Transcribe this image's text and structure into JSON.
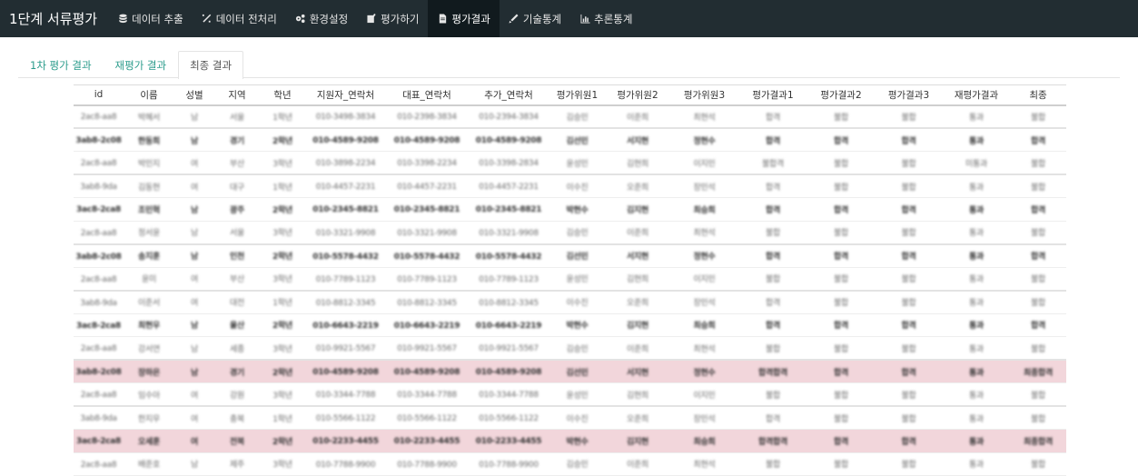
{
  "navbar": {
    "brand": "1단계 서류평가",
    "items": [
      {
        "label": "데이터 추출",
        "icon": "database-icon",
        "active": false
      },
      {
        "label": "데이터 전처리",
        "icon": "wand-icon",
        "active": false
      },
      {
        "label": "환경설정",
        "icon": "gears-icon",
        "active": false
      },
      {
        "label": "평가하기",
        "icon": "edit-icon",
        "active": false
      },
      {
        "label": "평가결과",
        "icon": "file-icon",
        "active": true
      },
      {
        "label": "기술통계",
        "icon": "pencil-icon",
        "active": false
      },
      {
        "label": "추론통계",
        "icon": "bar-chart-icon",
        "active": false
      }
    ]
  },
  "tabs": [
    {
      "label": "1차 평가 결과",
      "active": false
    },
    {
      "label": "재평가 결과",
      "active": false
    },
    {
      "label": "최종 결과",
      "active": true
    }
  ],
  "table": {
    "columns": [
      "id",
      "이름",
      "성별",
      "지역",
      "학년",
      "지원자_연락처",
      "대표_연락처",
      "추가_연락처",
      "평가위원1",
      "평가위원2",
      "평가위원3",
      "평가결과1",
      "평가결과2",
      "평가결과3",
      "재평가결과",
      "최종"
    ],
    "rows": [
      {
        "highlight": false,
        "separator": false,
        "bold": false,
        "cells": [
          "2ac8-aa8",
          "박혜서",
          "남",
          "서울",
          "1학년",
          "010-3498-3834",
          "010-2398-3834",
          "010-2394-3834",
          "김승민",
          "이준희",
          "최현석",
          "합격",
          "불합",
          "불합",
          "통과",
          "불합"
        ]
      },
      {
        "highlight": false,
        "separator": true,
        "bold": true,
        "cells": [
          "3ab8-2c08",
          "한동희",
          "남",
          "경기",
          "2학년",
          "010-4589-9208",
          "010-4589-9208",
          "010-4589-9208",
          "김선민",
          "서지현",
          "정현수",
          "합격",
          "합격",
          "합격",
          "통과",
          "합격"
        ]
      },
      {
        "highlight": false,
        "separator": false,
        "bold": false,
        "cells": [
          "2ac8-aa8",
          "박민지",
          "여",
          "부산",
          "3학년",
          "010-3898-2234",
          "010-3398-2234",
          "010-3398-2834",
          "윤성민",
          "김현희",
          "이지민",
          "불합격",
          "불합",
          "불합",
          "미통과",
          "불합"
        ]
      },
      {
        "highlight": false,
        "separator": true,
        "bold": false,
        "cells": [
          "3ab8-9da",
          "김동현",
          "여",
          "대구",
          "1학년",
          "010-4457-2231",
          "010-4457-2231",
          "010-4457-2231",
          "이수진",
          "오준희",
          "장민석",
          "합격",
          "불합",
          "불합",
          "통과",
          "불합"
        ]
      },
      {
        "highlight": false,
        "separator": false,
        "bold": true,
        "cells": [
          "3ac8-2ca8",
          "조민혁",
          "남",
          "광주",
          "2학년",
          "010-2345-8821",
          "010-2345-8821",
          "010-2345-8821",
          "박현수",
          "김지현",
          "최승희",
          "합격",
          "합격",
          "합격",
          "통과",
          "합격"
        ]
      },
      {
        "highlight": false,
        "separator": false,
        "bold": false,
        "cells": [
          "2ac8-aa8",
          "정서윤",
          "남",
          "서울",
          "3학년",
          "010-3321-9908",
          "010-3321-9908",
          "010-3321-9908",
          "김승민",
          "이준희",
          "최현석",
          "불합",
          "불합",
          "불합",
          "통과",
          "불합"
        ]
      },
      {
        "highlight": false,
        "separator": true,
        "bold": true,
        "cells": [
          "3ab8-2c08",
          "송지훈",
          "남",
          "인천",
          "2학년",
          "010-5578-4432",
          "010-5578-4432",
          "010-5578-4432",
          "김선민",
          "서지현",
          "정현수",
          "합격",
          "합격",
          "합격",
          "통과",
          "합격"
        ]
      },
      {
        "highlight": false,
        "separator": false,
        "bold": false,
        "cells": [
          "2ac8-aa8",
          "윤미",
          "여",
          "부산",
          "3학년",
          "010-7789-1123",
          "010-7789-1123",
          "010-7789-1123",
          "윤성민",
          "김현희",
          "이지민",
          "불합",
          "불합",
          "불합",
          "통과",
          "불합"
        ]
      },
      {
        "highlight": false,
        "separator": true,
        "bold": false,
        "cells": [
          "3ab8-9da",
          "이준서",
          "여",
          "대전",
          "1학년",
          "010-8812-3345",
          "010-8812-3345",
          "010-8812-3345",
          "이수진",
          "오준희",
          "장민석",
          "합격",
          "불합",
          "불합",
          "통과",
          "불합"
        ]
      },
      {
        "highlight": false,
        "separator": false,
        "bold": true,
        "cells": [
          "3ac8-2ca8",
          "최현우",
          "남",
          "울산",
          "2학년",
          "010-6643-2219",
          "010-6643-2219",
          "010-6643-2219",
          "박현수",
          "김지현",
          "최승희",
          "합격",
          "합격",
          "합격",
          "통과",
          "합격"
        ]
      },
      {
        "highlight": false,
        "separator": false,
        "bold": false,
        "cells": [
          "2ac8-aa8",
          "강서연",
          "남",
          "세종",
          "3학년",
          "010-9921-5567",
          "010-9921-5567",
          "010-9921-5567",
          "김승민",
          "이준희",
          "최현석",
          "불합",
          "불합",
          "불합",
          "통과",
          "불합"
        ]
      },
      {
        "highlight": true,
        "separator": true,
        "bold": true,
        "cells": [
          "3ab8-2c08",
          "장하은",
          "남",
          "경기",
          "2학년",
          "010-4589-9208",
          "010-4589-9208",
          "010-4589-9208",
          "김선민",
          "서지현",
          "정현수",
          "합격합격",
          "합격",
          "합격",
          "통과",
          "최종합격"
        ]
      },
      {
        "highlight": false,
        "separator": false,
        "bold": false,
        "cells": [
          "2ac8-aa8",
          "임수아",
          "여",
          "강원",
          "3학년",
          "010-3344-7788",
          "010-3344-7788",
          "010-3344-7788",
          "윤성민",
          "김현희",
          "이지민",
          "불합",
          "불합",
          "불합",
          "통과",
          "불합"
        ]
      },
      {
        "highlight": false,
        "separator": true,
        "bold": false,
        "cells": [
          "3ab8-9da",
          "한지우",
          "여",
          "충북",
          "1학년",
          "010-5566-1122",
          "010-5566-1122",
          "010-5566-1122",
          "이수진",
          "오준희",
          "장민석",
          "합격",
          "불합",
          "불합",
          "통과",
          "불합"
        ]
      },
      {
        "highlight": true,
        "separator": false,
        "bold": true,
        "cells": [
          "3ac8-2ca8",
          "오세훈",
          "여",
          "전북",
          "2학년",
          "010-2233-4455",
          "010-2233-4455",
          "010-2233-4455",
          "박현수",
          "김지현",
          "최승희",
          "합격합격",
          "합격",
          "합격",
          "통과",
          "최종합격"
        ]
      },
      {
        "highlight": false,
        "separator": false,
        "bold": false,
        "cells": [
          "2ac8-aa8",
          "배준호",
          "남",
          "제주",
          "3학년",
          "010-7788-9900",
          "010-7788-9900",
          "010-7788-9900",
          "김승민",
          "이준희",
          "최현석",
          "불합",
          "불합",
          "불합",
          "통과",
          "불합"
        ]
      }
    ]
  }
}
